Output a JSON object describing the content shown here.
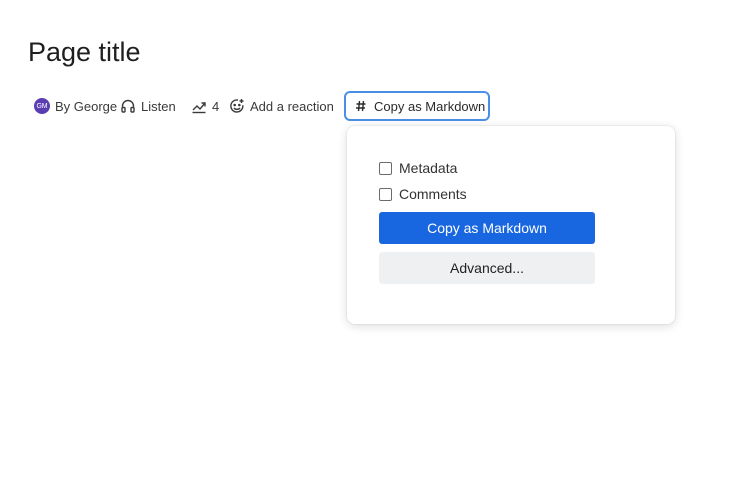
{
  "page": {
    "title": "Page title"
  },
  "byline": {
    "author": {
      "initials": "GM",
      "label": "By George",
      "avatar_color": "#5b3db3"
    },
    "listen": {
      "icon": "headphones-icon",
      "label": "Listen"
    },
    "views": {
      "icon": "trending-up-icon",
      "count": "4"
    },
    "reaction": {
      "icon": "add-emoji-icon",
      "label": "Add a reaction"
    },
    "copy_markdown": {
      "icon": "hash-icon",
      "label": "Copy as Markdown"
    }
  },
  "popover": {
    "options": [
      {
        "label": "Metadata",
        "checked": false
      },
      {
        "label": "Comments",
        "checked": false
      }
    ],
    "primary_button": "Copy as Markdown",
    "secondary_button": "Advanced...",
    "accent_color": "#1866e0"
  }
}
